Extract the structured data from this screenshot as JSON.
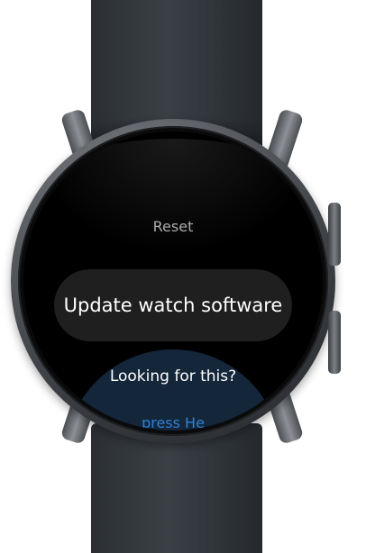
{
  "screen": {
    "title": "Reset",
    "primary_action": "Update watch software",
    "help_card": {
      "title": "Looking for this?",
      "link": "press He"
    }
  }
}
